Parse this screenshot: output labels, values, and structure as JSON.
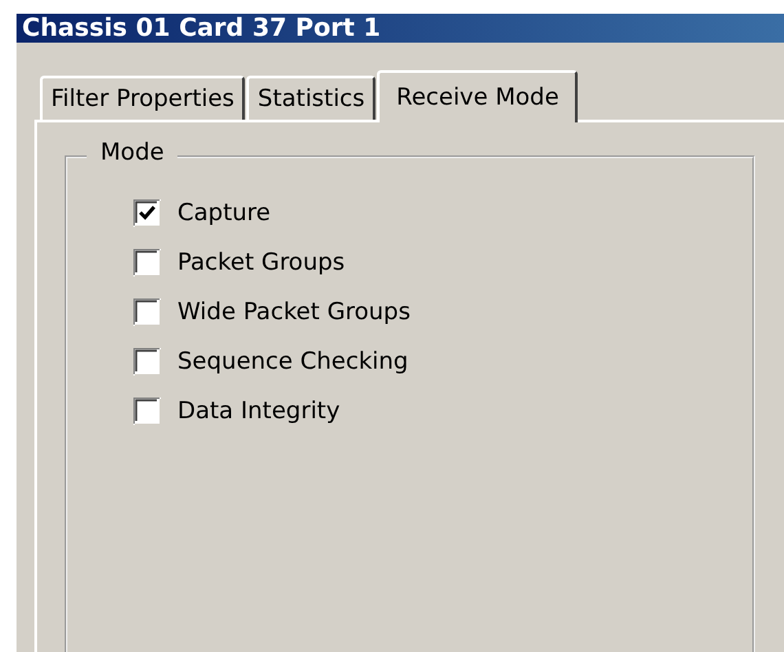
{
  "window": {
    "title": "Chassis 01 Card 37 Port 1"
  },
  "tabs": [
    {
      "label": "Filter Properties",
      "selected": false
    },
    {
      "label": "Statistics",
      "selected": false
    },
    {
      "label": "Receive Mode",
      "selected": true
    }
  ],
  "group": {
    "label": "Mode",
    "options": [
      {
        "label": "Capture",
        "checked": true
      },
      {
        "label": "Packet Groups",
        "checked": false
      },
      {
        "label": "Wide Packet Groups",
        "checked": false
      },
      {
        "label": "Sequence Checking",
        "checked": false
      },
      {
        "label": "Data Integrity",
        "checked": false
      }
    ]
  }
}
